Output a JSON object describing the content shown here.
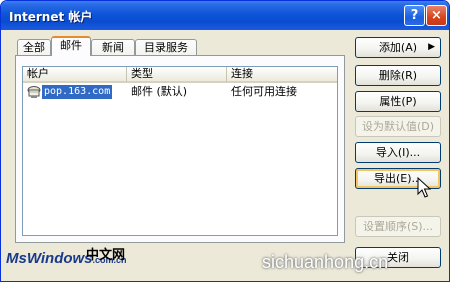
{
  "window": {
    "title": "Internet 帐户",
    "help_label": "?",
    "close_label": "×"
  },
  "tabs": [
    {
      "label": "全部",
      "active": false
    },
    {
      "label": "邮件",
      "active": true
    },
    {
      "label": "新闻",
      "active": false
    },
    {
      "label": "目录服务",
      "active": false
    }
  ],
  "list": {
    "columns": [
      "帐户",
      "类型",
      "连接"
    ],
    "rows": [
      {
        "account": "pop.163.com",
        "type": "邮件 (默认)",
        "connection": "任何可用连接",
        "selected": true,
        "icon": "mail-account-icon"
      }
    ]
  },
  "buttons": {
    "add": "添加(A)",
    "add_arrow": "▶",
    "remove": "删除(R)",
    "properties": "属性(P)",
    "set_default": "设为默认值(D)",
    "import": "导入(I)...",
    "export": "导出(E)...",
    "set_order": "设置顺序(S)...",
    "close": "关闭"
  },
  "watermarks": {
    "left_main": "MsWindows",
    "left_small": ".com.cn",
    "left_cn": "中文网",
    "right": "sichuanhong.cn"
  },
  "colors": {
    "titlebar": "#0a4ccf",
    "selection": "#316ac5",
    "active_tab_accent": "#e68b2c",
    "window_bg": "#ece9d8"
  }
}
